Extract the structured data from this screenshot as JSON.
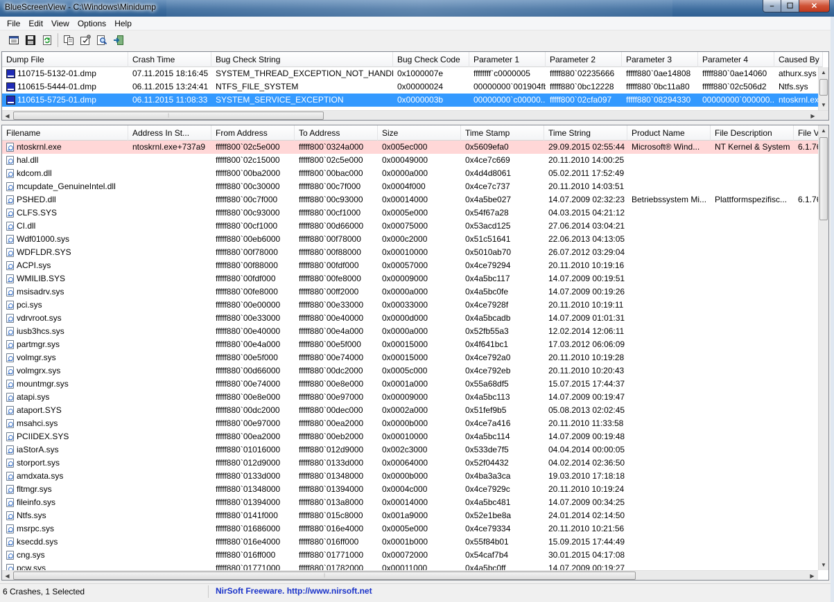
{
  "window": {
    "title": "BlueScreenView  -  C:\\Windows\\Minidump",
    "controls": {
      "minimize": "–",
      "maximize": "☐",
      "close": "✕"
    }
  },
  "menu": [
    "File",
    "Edit",
    "View",
    "Options",
    "Help"
  ],
  "toolbar": [
    "properties-icon",
    "save-icon",
    "refresh-icon",
    "copy-icon",
    "advanced-options-icon",
    "find-icon",
    "exit-icon"
  ],
  "crash_list": {
    "columns": [
      "Dump File",
      "Crash Time",
      "Bug Check String",
      "Bug Check Code",
      "Parameter 1",
      "Parameter 2",
      "Parameter 3",
      "Parameter 4",
      "Caused By"
    ],
    "sort_glyph": "△",
    "rows": [
      [
        "110715-5132-01.dmp",
        "07.11.2015 18:16:45",
        "SYSTEM_THREAD_EXCEPTION_NOT_HANDLED",
        "0x1000007e",
        "ffffffff`c0000005",
        "fffff880`02235666",
        "fffff880`0ae14808",
        "fffff880`0ae14060",
        "athurx.sys"
      ],
      [
        "110615-5444-01.dmp",
        "06.11.2015 13:24:41",
        "NTFS_FILE_SYSTEM",
        "0x00000024",
        "00000000`001904fb",
        "fffff880`0bc12228",
        "fffff880`0bc11a80",
        "fffff880`02c506d2",
        "Ntfs.sys"
      ],
      [
        "110615-5725-01.dmp",
        "06.11.2015 11:08:33",
        "SYSTEM_SERVICE_EXCEPTION",
        "0x0000003b",
        "00000000`c00000...",
        "fffff800`02cfa097",
        "fffff880`08294330",
        "00000000`000000...",
        "ntoskrnl.exe"
      ]
    ],
    "selected_index": 2
  },
  "driver_list": {
    "columns": [
      "Filename",
      "Address In St...",
      "From Address",
      "To Address",
      "Size",
      "Time Stamp",
      "Time String",
      "Product Name",
      "File Description",
      "File V"
    ],
    "sort_glyph": "∕",
    "rows": [
      [
        "ntoskrnl.exe",
        "ntoskrnl.exe+737a9",
        "fffff800`02c5e000",
        "fffff800`0324a000",
        "0x005ec000",
        "0x5609efa0",
        "29.09.2015 02:55:44",
        "Microsoft® Wind...",
        "NT Kernel & System",
        "6.1.76"
      ],
      [
        "hal.dll",
        "",
        "fffff800`02c15000",
        "fffff800`02c5e000",
        "0x00049000",
        "0x4ce7c669",
        "20.11.2010 14:00:25",
        "",
        "",
        ""
      ],
      [
        "kdcom.dll",
        "",
        "fffff800`00ba2000",
        "fffff800`00bac000",
        "0x0000a000",
        "0x4d4d8061",
        "05.02.2011 17:52:49",
        "",
        "",
        ""
      ],
      [
        "mcupdate_GenuineIntel.dll",
        "",
        "fffff880`00c30000",
        "fffff880`00c7f000",
        "0x0004f000",
        "0x4ce7c737",
        "20.11.2010 14:03:51",
        "",
        "",
        ""
      ],
      [
        "PSHED.dll",
        "",
        "fffff880`00c7f000",
        "fffff880`00c93000",
        "0x00014000",
        "0x4a5be027",
        "14.07.2009 02:32:23",
        "Betriebssystem Mi...",
        "Plattformspezifisc...",
        "6.1.76"
      ],
      [
        "CLFS.SYS",
        "",
        "fffff880`00c93000",
        "fffff880`00cf1000",
        "0x0005e000",
        "0x54f67a28",
        "04.03.2015 04:21:12",
        "",
        "",
        ""
      ],
      [
        "CI.dll",
        "",
        "fffff880`00cf1000",
        "fffff880`00d66000",
        "0x00075000",
        "0x53acd125",
        "27.06.2014 03:04:21",
        "",
        "",
        ""
      ],
      [
        "Wdf01000.sys",
        "",
        "fffff880`00eb6000",
        "fffff880`00f78000",
        "0x000c2000",
        "0x51c51641",
        "22.06.2013 04:13:05",
        "",
        "",
        ""
      ],
      [
        "WDFLDR.SYS",
        "",
        "fffff880`00f78000",
        "fffff880`00f88000",
        "0x00010000",
        "0x5010ab70",
        "26.07.2012 03:29:04",
        "",
        "",
        ""
      ],
      [
        "ACPI.sys",
        "",
        "fffff880`00f88000",
        "fffff880`00fdf000",
        "0x00057000",
        "0x4ce79294",
        "20.11.2010 10:19:16",
        "",
        "",
        ""
      ],
      [
        "WMILIB.SYS",
        "",
        "fffff880`00fdf000",
        "fffff880`00fe8000",
        "0x00009000",
        "0x4a5bc117",
        "14.07.2009 00:19:51",
        "",
        "",
        ""
      ],
      [
        "msisadrv.sys",
        "",
        "fffff880`00fe8000",
        "fffff880`00ff2000",
        "0x0000a000",
        "0x4a5bc0fe",
        "14.07.2009 00:19:26",
        "",
        "",
        ""
      ],
      [
        "pci.sys",
        "",
        "fffff880`00e00000",
        "fffff880`00e33000",
        "0x00033000",
        "0x4ce7928f",
        "20.11.2010 10:19:11",
        "",
        "",
        ""
      ],
      [
        "vdrvroot.sys",
        "",
        "fffff880`00e33000",
        "fffff880`00e40000",
        "0x0000d000",
        "0x4a5bcadb",
        "14.07.2009 01:01:31",
        "",
        "",
        ""
      ],
      [
        "iusb3hcs.sys",
        "",
        "fffff880`00e40000",
        "fffff880`00e4a000",
        "0x0000a000",
        "0x52fb55a3",
        "12.02.2014 12:06:11",
        "",
        "",
        ""
      ],
      [
        "partmgr.sys",
        "",
        "fffff880`00e4a000",
        "fffff880`00e5f000",
        "0x00015000",
        "0x4f641bc1",
        "17.03.2012 06:06:09",
        "",
        "",
        ""
      ],
      [
        "volmgr.sys",
        "",
        "fffff880`00e5f000",
        "fffff880`00e74000",
        "0x00015000",
        "0x4ce792a0",
        "20.11.2010 10:19:28",
        "",
        "",
        ""
      ],
      [
        "volmgrx.sys",
        "",
        "fffff880`00d66000",
        "fffff880`00dc2000",
        "0x0005c000",
        "0x4ce792eb",
        "20.11.2010 10:20:43",
        "",
        "",
        ""
      ],
      [
        "mountmgr.sys",
        "",
        "fffff880`00e74000",
        "fffff880`00e8e000",
        "0x0001a000",
        "0x55a68df5",
        "15.07.2015 17:44:37",
        "",
        "",
        ""
      ],
      [
        "atapi.sys",
        "",
        "fffff880`00e8e000",
        "fffff880`00e97000",
        "0x00009000",
        "0x4a5bc113",
        "14.07.2009 00:19:47",
        "",
        "",
        ""
      ],
      [
        "ataport.SYS",
        "",
        "fffff880`00dc2000",
        "fffff880`00dec000",
        "0x0002a000",
        "0x51fef9b5",
        "05.08.2013 02:02:45",
        "",
        "",
        ""
      ],
      [
        "msahci.sys",
        "",
        "fffff880`00e97000",
        "fffff880`00ea2000",
        "0x0000b000",
        "0x4ce7a416",
        "20.11.2010 11:33:58",
        "",
        "",
        ""
      ],
      [
        "PCIIDEX.SYS",
        "",
        "fffff880`00ea2000",
        "fffff880`00eb2000",
        "0x00010000",
        "0x4a5bc114",
        "14.07.2009 00:19:48",
        "",
        "",
        ""
      ],
      [
        "iaStorA.sys",
        "",
        "fffff880`01016000",
        "fffff880`012d9000",
        "0x002c3000",
        "0x533de7f5",
        "04.04.2014 00:00:05",
        "",
        "",
        ""
      ],
      [
        "storport.sys",
        "",
        "fffff880`012d9000",
        "fffff880`0133d000",
        "0x00064000",
        "0x52f04432",
        "04.02.2014 02:36:50",
        "",
        "",
        ""
      ],
      [
        "amdxata.sys",
        "",
        "fffff880`0133d000",
        "fffff880`01348000",
        "0x0000b000",
        "0x4ba3a3ca",
        "19.03.2010 17:18:18",
        "",
        "",
        ""
      ],
      [
        "fltmgr.sys",
        "",
        "fffff880`01348000",
        "fffff880`01394000",
        "0x0004c000",
        "0x4ce7929c",
        "20.11.2010 10:19:24",
        "",
        "",
        ""
      ],
      [
        "fileinfo.sys",
        "",
        "fffff880`01394000",
        "fffff880`013a8000",
        "0x00014000",
        "0x4a5bc481",
        "14.07.2009 00:34:25",
        "",
        "",
        ""
      ],
      [
        "Ntfs.sys",
        "",
        "fffff880`0141f000",
        "fffff880`015c8000",
        "0x001a9000",
        "0x52e1be8a",
        "24.01.2014 02:14:50",
        "",
        "",
        ""
      ],
      [
        "msrpc.sys",
        "",
        "fffff880`01686000",
        "fffff880`016e4000",
        "0x0005e000",
        "0x4ce79334",
        "20.11.2010 10:21:56",
        "",
        "",
        ""
      ],
      [
        "ksecdd.sys",
        "",
        "fffff880`016e4000",
        "fffff880`016ff000",
        "0x0001b000",
        "0x55f84b01",
        "15.09.2015 17:44:49",
        "",
        "",
        ""
      ],
      [
        "cng.sys",
        "",
        "fffff880`016ff000",
        "fffff880`01771000",
        "0x00072000",
        "0x54caf7b4",
        "30.01.2015 04:17:08",
        "",
        "",
        ""
      ],
      [
        "pcw.sys",
        "",
        "fffff880`01771000",
        "fffff880`01782000",
        "0x00011000",
        "0x4a5bc0ff",
        "14.07.2009 00:19:27",
        "",
        "",
        ""
      ]
    ]
  },
  "statusbar": {
    "summary": "6 Crashes, 1 Selected",
    "link": "NirSoft Freeware.  http://www.nirsoft.net"
  },
  "colors": {
    "selection": "#3399ff",
    "highlight_row": "#ffd7d7",
    "link": "#1a33c9"
  }
}
